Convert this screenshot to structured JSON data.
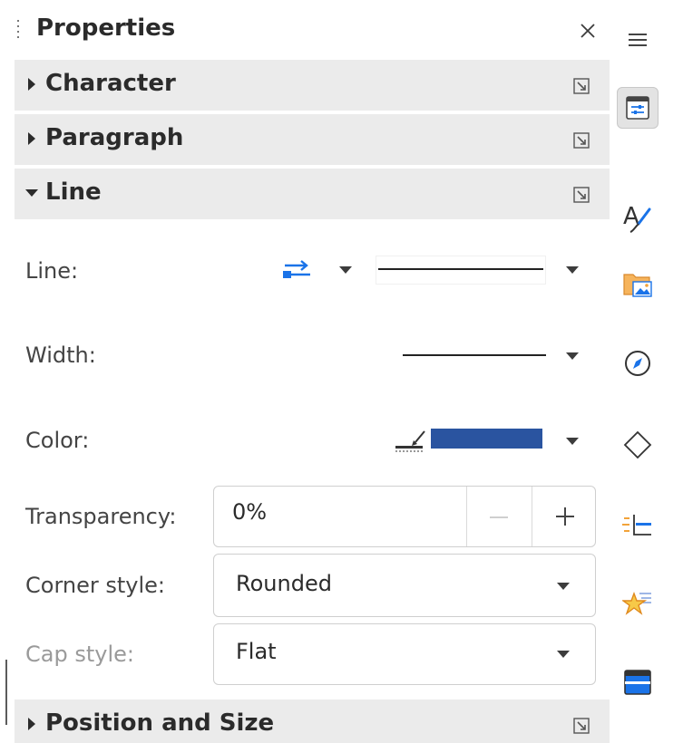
{
  "panel": {
    "title": "Properties",
    "close_glyph": "×"
  },
  "sections": {
    "character": "Character",
    "paragraph": "Paragraph",
    "line": "Line",
    "position_size": "Position and Size"
  },
  "line_section": {
    "line_label": "Line:",
    "width_label": "Width:",
    "color_label": "Color:",
    "color_value": "#2a54a0",
    "transparency_label": "Transparency:",
    "transparency_value": "0%",
    "corner_label": "Corner style:",
    "corner_value": "Rounded",
    "cap_label": "Cap style:",
    "cap_value": "Flat"
  },
  "sidebar_icons": [
    "menu-icon",
    "properties-icon",
    "styles-icon",
    "gallery-icon",
    "navigator-icon",
    "shapes-icon",
    "page-icon",
    "animation-icon",
    "design-icon"
  ],
  "accent": "#1a73e8"
}
